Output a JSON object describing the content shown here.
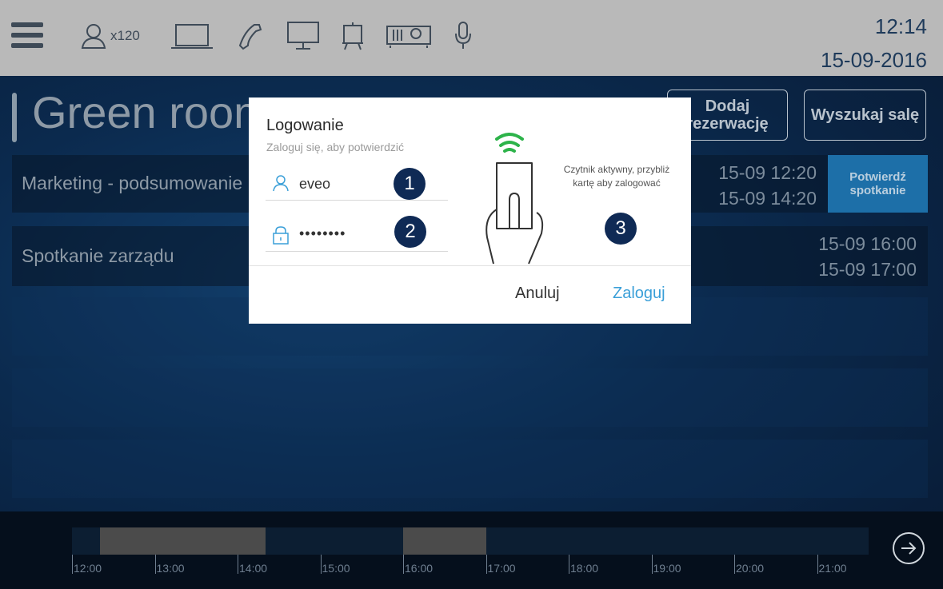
{
  "topbar": {
    "capacity": "x120",
    "icons": [
      "menu-icon",
      "person-icon",
      "laptop-icon",
      "phone-icon",
      "monitor-icon",
      "flipchart-icon",
      "projector-icon",
      "microphone-icon"
    ],
    "time": "12:14",
    "date": "15-09-2016"
  },
  "room": {
    "name": "Green room"
  },
  "actions": {
    "add_reservation": "Dodaj rezerwację",
    "search_room": "Wyszukaj salę"
  },
  "meetings": [
    {
      "title": "Marketing - podsumowanie",
      "start": "15-09 12:20",
      "end": "15-09 14:20",
      "confirm_label": "Potwierdź spotkanie"
    },
    {
      "title": "Spotkanie zarządu",
      "start": "15-09 16:00",
      "end": "15-09 17:00"
    }
  ],
  "timeline": {
    "ticks": [
      "12:00",
      "13:00",
      "14:00",
      "15:00",
      "16:00",
      "17:00",
      "18:00",
      "19:00",
      "20:00",
      "21:00"
    ],
    "busy": [
      {
        "from": "12:20",
        "to": "14:20"
      },
      {
        "from": "16:00",
        "to": "17:00"
      }
    ]
  },
  "login_modal": {
    "title": "Logowanie",
    "subtitle": "Zaloguj się, aby potwierdzić",
    "username_value": "eveo",
    "password_value": "••••••••",
    "reader_text": "Czytnik aktywny, przybliż kartę aby zalogować",
    "badges": [
      "1",
      "2",
      "3"
    ],
    "cancel_label": "Anuluj",
    "login_label": "Zaloguj",
    "accent_color": "#3a9fd8",
    "wifi_color": "#2db34a"
  }
}
